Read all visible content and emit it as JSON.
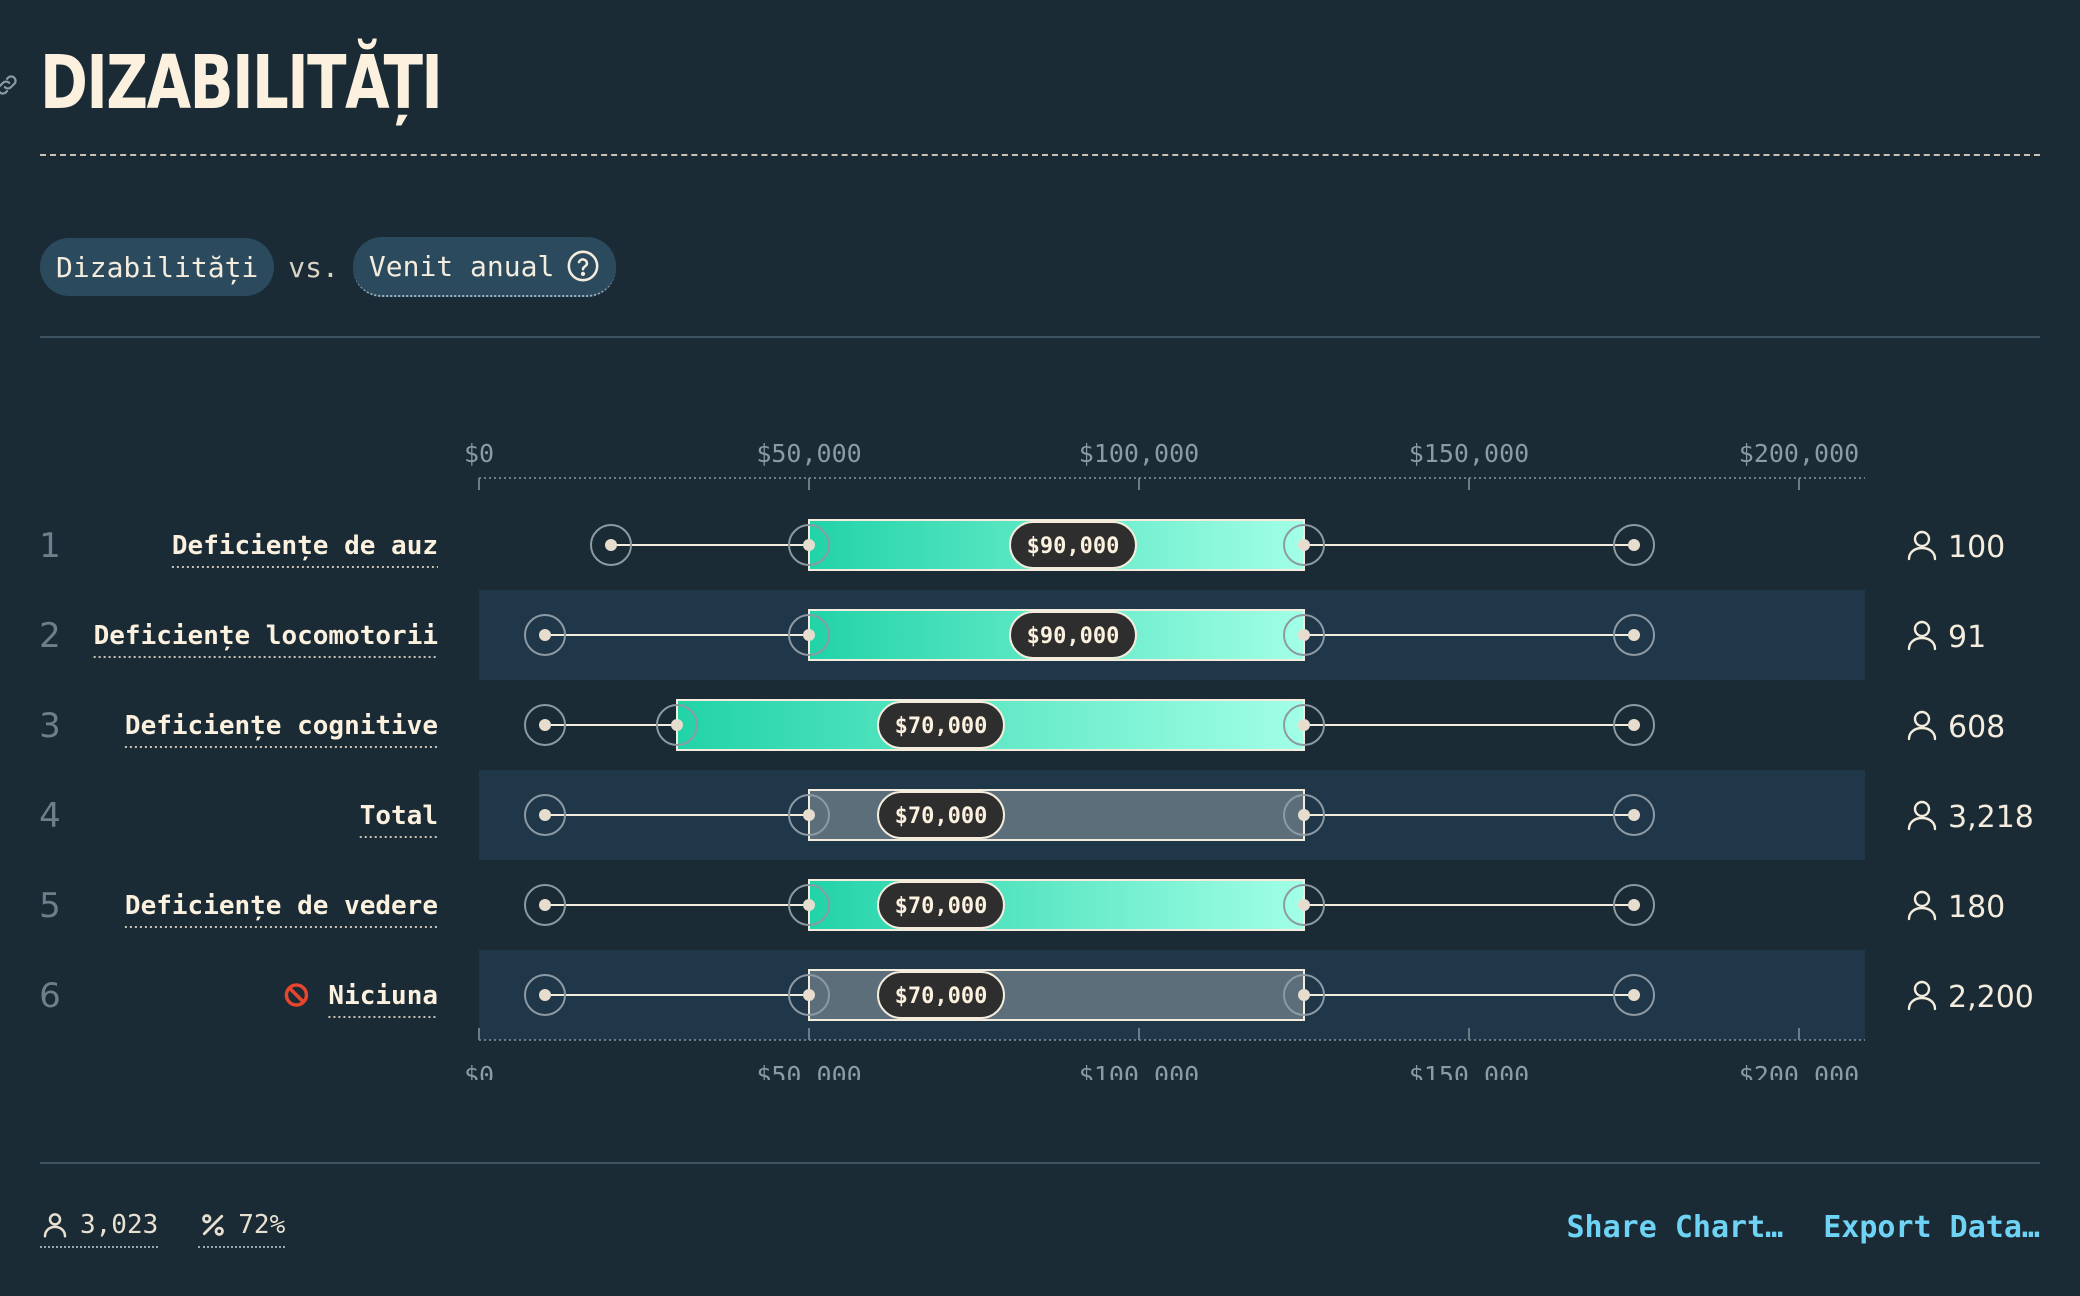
{
  "page": {
    "title": "DIZABILITĂȚI"
  },
  "filters": {
    "group": "Dizabilități",
    "vs": "vs.",
    "measure": "Venit anual"
  },
  "chart_data": {
    "type": "box",
    "x_ticks": [
      "$0",
      "$50,000",
      "$100,000",
      "$150,000",
      "$200,000"
    ],
    "x_tick_values": [
      0,
      50000,
      100000,
      150000,
      200000
    ],
    "xlim": [
      0,
      210000
    ],
    "series": [
      {
        "rank": "1",
        "label": "Deficiențe de auz",
        "min": 20000,
        "q1": 50000,
        "median": 90000,
        "median_label": "$90,000",
        "q3": 125000,
        "max": 175000,
        "count": "100",
        "highlight": true,
        "icon": ""
      },
      {
        "rank": "2",
        "label": "Deficiențe locomotorii",
        "min": 10000,
        "q1": 50000,
        "median": 90000,
        "median_label": "$90,000",
        "q3": 125000,
        "max": 175000,
        "count": "91",
        "highlight": true,
        "icon": ""
      },
      {
        "rank": "3",
        "label": "Deficiențe cognitive",
        "min": 10000,
        "q1": 30000,
        "median": 70000,
        "median_label": "$70,000",
        "q3": 125000,
        "max": 175000,
        "count": "608",
        "highlight": true,
        "icon": ""
      },
      {
        "rank": "4",
        "label": "Total",
        "min": 10000,
        "q1": 50000,
        "median": 70000,
        "median_label": "$70,000",
        "q3": 125000,
        "max": 175000,
        "count": "3,218",
        "highlight": false,
        "icon": ""
      },
      {
        "rank": "5",
        "label": "Deficiențe de vedere",
        "min": 10000,
        "q1": 50000,
        "median": 70000,
        "median_label": "$70,000",
        "q3": 125000,
        "max": 175000,
        "count": "180",
        "highlight": true,
        "icon": ""
      },
      {
        "rank": "6",
        "label": "Niciuna",
        "min": 10000,
        "q1": 50000,
        "median": 70000,
        "median_label": "$70,000",
        "q3": 125000,
        "max": 175000,
        "count": "2,200",
        "highlight": false,
        "icon": "no-entry-icon"
      }
    ]
  },
  "footer": {
    "respondents": "3,023",
    "percent": "72%"
  },
  "actions": {
    "share": "Share Chart…",
    "export": "Export Data…"
  },
  "colors": {
    "background": "#1a2b36",
    "row_band": "#1f3749",
    "box_gradient_start": "#22d3a8",
    "box_gradient_end": "#a2ffe6",
    "box_neutral": "#5d6e7b",
    "link": "#6ed3f4"
  }
}
